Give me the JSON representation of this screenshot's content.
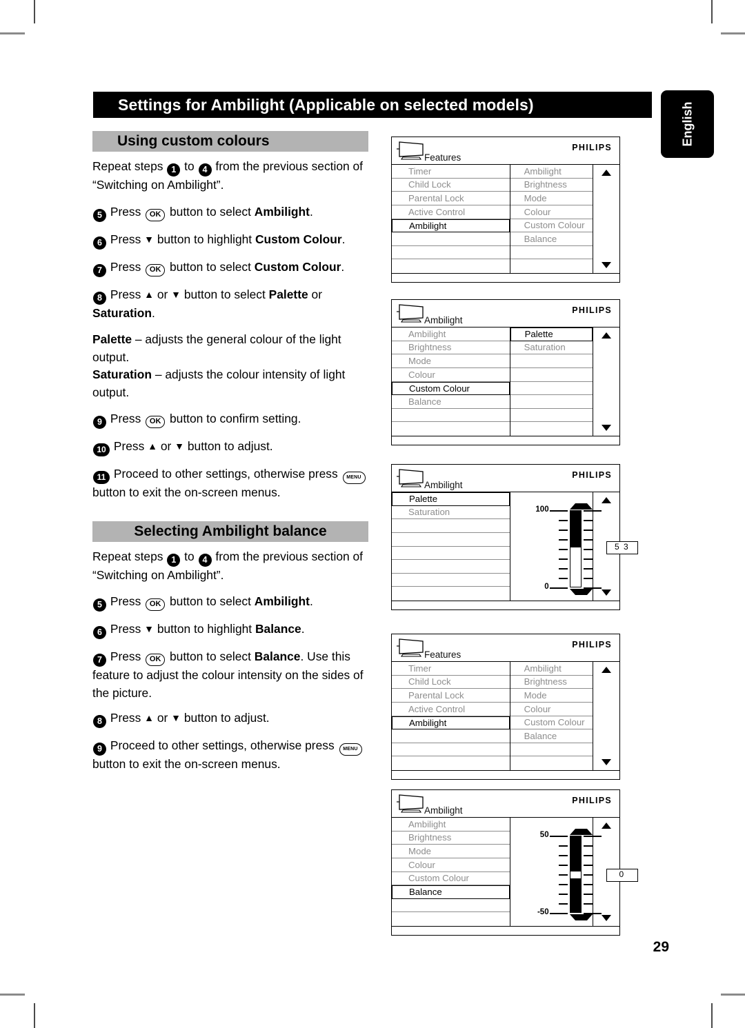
{
  "page": {
    "title": "Settings for Ambilight (Applicable on selected models)",
    "language_tab": "English",
    "page_number": "29"
  },
  "sections": [
    {
      "heading": "Using custom colours",
      "paragraphs": [
        {
          "kind": "intro",
          "text": "Repeat steps 1 to 4 from the previous section of “Switching on Ambilight”."
        },
        {
          "kind": "step",
          "number": "5",
          "text": "Press OK button to select Ambilight."
        },
        {
          "kind": "step",
          "number": "6",
          "text": "Press ▼ button to highlight Custom Colour."
        },
        {
          "kind": "step",
          "number": "7",
          "text": "Press OK button to select Custom Colour."
        },
        {
          "kind": "step",
          "number": "8",
          "text": "Press ▲ or ▼ button to select Palette or Saturation."
        },
        {
          "kind": "note",
          "text": "Palette – adjusts the general colour of the light output. Saturation – adjusts the colour intensity of light output."
        },
        {
          "kind": "step",
          "number": "9",
          "text": "Press OK button to confirm setting."
        },
        {
          "kind": "step",
          "number": "10",
          "text": "Press ▲ or ▼ button to adjust."
        },
        {
          "kind": "step",
          "number": "11",
          "text": "Proceed to other settings, otherwise press MENU button to exit the on-screen menus."
        }
      ]
    },
    {
      "heading": "Selecting Ambilight balance",
      "paragraphs": [
        {
          "kind": "intro",
          "text": "Repeat steps 1 to 4 from the previous section of “Switching on Ambilight”."
        },
        {
          "kind": "step",
          "number": "5",
          "text": "Press OK button to select Ambilight."
        },
        {
          "kind": "step",
          "number": "6",
          "text": "Press ▼ button to highlight Balance."
        },
        {
          "kind": "step",
          "number": "7",
          "text": "Press OK button to select Balance. Use this feature to adjust the colour intensity on the sides of the picture."
        },
        {
          "kind": "step",
          "number": "8",
          "text": "Press ▲ or ▼ button to adjust."
        },
        {
          "kind": "step",
          "number": "9",
          "text": "Proceed to other settings, otherwise press MENU button to exit the on-screen menus."
        }
      ]
    }
  ],
  "text": {
    "repeat_prefix": "Repeat steps",
    "repeat_to": "to",
    "repeat_suffix": "from the previous",
    "repeat_line2": "section of “Switching on Ambilight”.",
    "press": "Press",
    "button_to_select": "button to select",
    "button_to_highlight": "button to highlight",
    "button_to_confirm": "button to confirm setting.",
    "button_to_adjust": "button to adjust.",
    "or": "or",
    "ambilight": "Ambilight",
    "custom": "Custom",
    "colour": "Colour",
    "custom_colour": "Custom Colour",
    "balance": "Balance",
    "palette": "Palette",
    "saturation": "Saturation",
    "dot": ".",
    "palette_desc_bold": "Palette",
    "palette_desc": "– adjusts the general colour of the",
    "palette_desc2": "light output.",
    "sat_desc_bold": "Saturation",
    "sat_desc": "– adjusts the colour intensity of",
    "sat_desc2": "light output.",
    "proceed": "Proceed to other settings, otherwise",
    "press_menu": "press",
    "exit": "button to exit the on-screen menus.",
    "use_feature1": "Use this feature to adjust the colour intensity",
    "use_feature2": "on the sides of the picture.",
    "step1": "1",
    "step4": "4",
    "step5": "5",
    "step6": "6",
    "step7": "7",
    "step8": "8",
    "step9": "9",
    "step10": "10",
    "step11": "11",
    "key_ok": "OK",
    "key_menu": "MENU",
    "arrow_up": "▲",
    "arrow_down": "▼"
  },
  "osd": {
    "brand": "PHILIPS",
    "screens": [
      {
        "id": "features-ambilight-1",
        "title": "Features",
        "col1": [
          "Timer",
          "Child Lock",
          "Parental Lock",
          "Active Control",
          "Ambilight",
          "",
          "",
          ""
        ],
        "col1_highlight": 4,
        "col2": [
          "Ambilight",
          "Brightness",
          "Mode",
          "Colour",
          "Custom Colour",
          "Balance",
          "",
          ""
        ],
        "col2_highlight": -1,
        "has_slider": false
      },
      {
        "id": "ambilight-custom-colour",
        "title": "Ambilight",
        "col1": [
          "Ambilight",
          "Brightness",
          "Mode",
          "Colour",
          "Custom Colour",
          "Balance",
          "",
          ""
        ],
        "col1_highlight": 4,
        "col2": [
          "Palette",
          "Saturation",
          "",
          "",
          "",
          "",
          "",
          ""
        ],
        "col2_highlight": 0,
        "has_slider": false
      },
      {
        "id": "ambilight-palette-slider",
        "title": "Ambilight",
        "col1": [
          "Palette",
          "Saturation",
          "",
          "",
          "",
          "",
          "",
          ""
        ],
        "col1_highlight": 0,
        "has_slider": true,
        "slider": {
          "max_label": "100",
          "min_label": "0",
          "value": "5 3",
          "value_number": 53,
          "min": 0,
          "max": 100,
          "style": "fill-from-top"
        }
      },
      {
        "id": "features-ambilight-2",
        "title": "Features",
        "col1": [
          "Timer",
          "Child Lock",
          "Parental Lock",
          "Active Control",
          "Ambilight",
          "",
          "",
          ""
        ],
        "col1_highlight": 4,
        "col2": [
          "Ambilight",
          "Brightness",
          "Mode",
          "Colour",
          "Custom Colour",
          "Balance",
          "",
          ""
        ],
        "col2_highlight": -1,
        "has_slider": false
      },
      {
        "id": "ambilight-balance-slider",
        "title": "Ambilight",
        "col1": [
          "Ambilight",
          "Brightness",
          "Mode",
          "Colour",
          "Custom Colour",
          "Balance",
          "",
          ""
        ],
        "col1_highlight": 5,
        "has_slider": true,
        "slider": {
          "max_label": "50",
          "min_label": "-50",
          "value": "0",
          "value_number": 0,
          "min": -50,
          "max": 50,
          "style": "knob-on-black"
        }
      }
    ]
  },
  "colors": {
    "title_bar_bg": "#000000",
    "section_head_bg": "#b3b3b3",
    "menu_dim_text": "#8d8d8d",
    "menu_active_text": "#000000"
  }
}
